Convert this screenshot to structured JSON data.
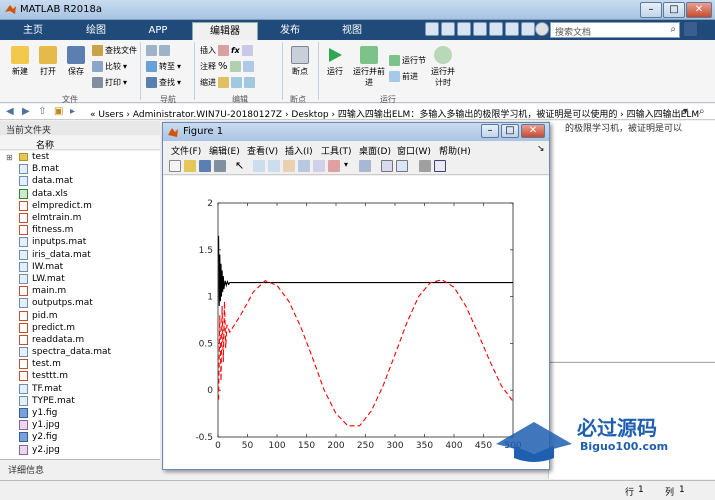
{
  "app": {
    "title": "MATLAB R2018a"
  },
  "tabs": [
    {
      "label": "主页",
      "active": false
    },
    {
      "label": "绘图",
      "active": false
    },
    {
      "label": "APP",
      "active": false
    },
    {
      "label": "编辑器",
      "active": true
    },
    {
      "label": "发布",
      "active": false
    },
    {
      "label": "视图",
      "active": false
    }
  ],
  "search": {
    "placeholder": "搜索文档"
  },
  "ribbon": {
    "new": "新建",
    "open": "打开",
    "save": "保存",
    "find_files": "查找文件",
    "compare": "比较",
    "print": "打印",
    "goto": "转至",
    "find": "查找",
    "insert": "插入",
    "comment": "注释",
    "indent": "缩进",
    "fx": "fx",
    "breakpoint": "断点",
    "run": "运行",
    "run_advance": "运行并前进",
    "run_section": "运行节",
    "advance": "前进",
    "run_time": "运行并计时",
    "groups": {
      "file": "文件",
      "navigate": "导航",
      "edit": "编辑",
      "breakpoints": "断点",
      "run": "运行"
    }
  },
  "address": {
    "path": "« Users › Administrator.WIN7U-20180127Z › Desktop › 四输入四输出ELM：多输入多输出的极限学习机，被证明是可以使用的 › 四输入四输出ELM"
  },
  "current_folder": {
    "title": "当前文件夹",
    "name_col": "名称",
    "files": [
      {
        "name": "test",
        "type": "folder"
      },
      {
        "name": "B.mat",
        "type": "mat"
      },
      {
        "name": "data.mat",
        "type": "mat"
      },
      {
        "name": "data.xls",
        "type": "xls"
      },
      {
        "name": "elmpredict.m",
        "type": "m"
      },
      {
        "name": "elmtrain.m",
        "type": "m"
      },
      {
        "name": "fitness.m",
        "type": "m"
      },
      {
        "name": "inputps.mat",
        "type": "mat"
      },
      {
        "name": "iris_data.mat",
        "type": "mat"
      },
      {
        "name": "IW.mat",
        "type": "mat"
      },
      {
        "name": "LW.mat",
        "type": "mat"
      },
      {
        "name": "main.m",
        "type": "m"
      },
      {
        "name": "outputps.mat",
        "type": "mat"
      },
      {
        "name": "pid.m",
        "type": "m"
      },
      {
        "name": "predict.m",
        "type": "m"
      },
      {
        "name": "readdata.m",
        "type": "m"
      },
      {
        "name": "spectra_data.mat",
        "type": "mat"
      },
      {
        "name": "test.m",
        "type": "m"
      },
      {
        "name": "testtt.m",
        "type": "m"
      },
      {
        "name": "TF.mat",
        "type": "mat"
      },
      {
        "name": "TYPE.mat",
        "type": "mat"
      },
      {
        "name": "y1.fig",
        "type": "fig"
      },
      {
        "name": "y1.jpg",
        "type": "jpg"
      },
      {
        "name": "y2.fig",
        "type": "fig"
      },
      {
        "name": "y2.jpg",
        "type": "jpg"
      }
    ],
    "details": "详细信息"
  },
  "right_pane": {
    "path_fragment": "的极限学习机，被证明是可以..."
  },
  "status": {
    "row_label": "行",
    "row": "1",
    "col_label": "列",
    "col": "1"
  },
  "figure": {
    "title": "Figure 1",
    "menu": [
      "文件(F)",
      "编辑(E)",
      "查看(V)",
      "插入(I)",
      "工具(T)",
      "桌面(D)",
      "窗口(W)",
      "帮助(H)"
    ]
  },
  "watermark": {
    "text": "必过源码",
    "sub": "Biguo100.com"
  },
  "chart_data": {
    "type": "line",
    "title": "",
    "xlabel": "",
    "ylabel": "",
    "xlim": [
      0,
      500
    ],
    "ylim": [
      -0.5,
      2
    ],
    "xticks": [
      0,
      50,
      100,
      150,
      200,
      250,
      300,
      350,
      400,
      450,
      500
    ],
    "yticks": [
      -0.5,
      0,
      0.5,
      1,
      1.5,
      2
    ],
    "grid": false,
    "series": [
      {
        "color": "#000000",
        "style": "solid",
        "description_points": "oscillation near x=0-20 then constant",
        "x": [
          1,
          2,
          3,
          4,
          5,
          6,
          7,
          8,
          9,
          10,
          12,
          14,
          16,
          18,
          20,
          25,
          30,
          500
        ],
        "y": [
          1.65,
          0.9,
          1.45,
          0.95,
          1.35,
          1.0,
          1.28,
          1.05,
          1.22,
          1.08,
          1.17,
          1.12,
          1.16,
          1.13,
          1.15,
          1.15,
          1.15,
          1.15
        ]
      },
      {
        "color": "#ff0000",
        "style": "dashed",
        "x": [
          1,
          3,
          5,
          7,
          9,
          11,
          13,
          15,
          20,
          40,
          60,
          80,
          100,
          120,
          140,
          160,
          180,
          200,
          220,
          240,
          260,
          280,
          300,
          320,
          340,
          360,
          380,
          400,
          420,
          440,
          460,
          480,
          500
        ],
        "y": [
          -0.1,
          0.8,
          0.1,
          0.9,
          0.3,
          0.95,
          0.45,
          0.7,
          0.62,
          0.82,
          1.05,
          1.17,
          1.12,
          0.95,
          0.68,
          0.35,
          0.0,
          -0.25,
          -0.38,
          -0.38,
          -0.22,
          0.05,
          0.38,
          0.72,
          1.0,
          1.15,
          1.18,
          1.1,
          0.9,
          0.62,
          0.32,
          0.05,
          -0.12
        ]
      }
    ]
  }
}
